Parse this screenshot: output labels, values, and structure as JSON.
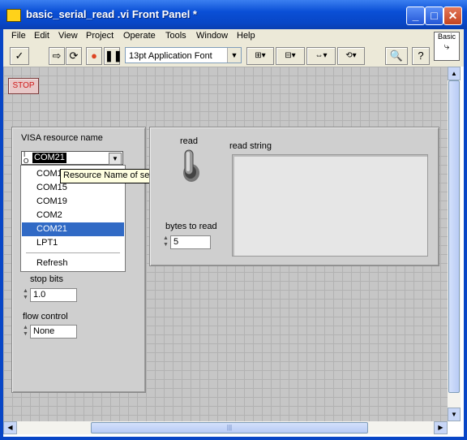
{
  "window": {
    "title": "basic_serial_read .vi Front Panel *",
    "controls": {
      "minimize": "_",
      "maximize": "□",
      "close": "✕"
    }
  },
  "menu": [
    "File",
    "Edit",
    "View",
    "Project",
    "Operate",
    "Tools",
    "Window",
    "Help"
  ],
  "toolbar": {
    "font_select": "13pt Application Font",
    "palette_label": "Basic"
  },
  "panel": {
    "stop_button": "STOP",
    "visa": {
      "label": "VISA resource name",
      "io_prefix": "I/O",
      "value": "COM21",
      "tooltip": "Resource Name of serial port.",
      "options": [
        "COM1",
        "COM15",
        "COM19",
        "COM2",
        "COM21",
        "LPT1"
      ],
      "selected": "COM21",
      "refresh": "Refresh"
    },
    "stop_bits": {
      "label": "stop bits",
      "value": "1.0"
    },
    "flow_control": {
      "label": "flow control",
      "value": "None"
    },
    "read": {
      "label": "read"
    },
    "read_string": {
      "label": "read string",
      "value": ""
    },
    "bytes_to_read": {
      "label": "bytes to read",
      "value": "5"
    }
  }
}
